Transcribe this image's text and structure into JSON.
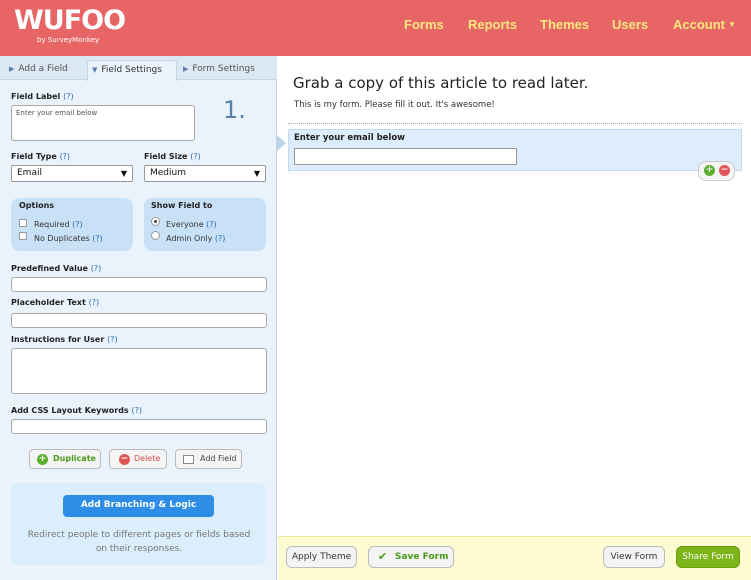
{
  "header": {
    "logo": "WUFOO",
    "logo_sub": "by SurveyMonkey",
    "nav": {
      "forms": "Forms",
      "reports": "Reports",
      "themes": "Themes",
      "users": "Users",
      "account": "Account"
    },
    "colors": {
      "background": "#e86565",
      "nav_text": "#f9e87f"
    }
  },
  "sidebar": {
    "tabs": {
      "add_field": "Add a Field",
      "field_settings": "Field Settings",
      "form_settings": "Form Settings"
    },
    "active_tab": "Field Settings",
    "field_number": "1.",
    "field_label": {
      "label": "Field Label",
      "help": "(?)",
      "value": "Enter your email below"
    },
    "field_type": {
      "label": "Field Type",
      "help": "(?)",
      "value": "Email"
    },
    "field_size": {
      "label": "Field Size",
      "help": "(?)",
      "value": "Medium"
    },
    "options": {
      "title": "Options",
      "required": {
        "label": "Required",
        "help": "(?)",
        "checked": false
      },
      "no_duplicates": {
        "label": "No Duplicates",
        "help": "(?)",
        "checked": false
      }
    },
    "show_field_to": {
      "title": "Show Field to",
      "everyone": {
        "label": "Everyone",
        "help": "(?)",
        "selected": true
      },
      "admin_only": {
        "label": "Admin Only",
        "help": "(?)",
        "selected": false
      }
    },
    "predefined_value": {
      "label": "Predefined Value",
      "help": "(?)",
      "value": ""
    },
    "placeholder_text": {
      "label": "Placeholder Text",
      "help": "(?)",
      "value": ""
    },
    "instructions": {
      "label": "Instructions for User",
      "help": "(?)",
      "value": ""
    },
    "css_keywords": {
      "label": "Add CSS Layout Keywords",
      "help": "(?)",
      "value": ""
    },
    "buttons": {
      "duplicate": "Duplicate",
      "delete": "Delete",
      "add_field": "Add Field"
    },
    "logic": {
      "button": "Add Branching & Logic",
      "text": "Redirect people to different pages or fields based on their responses."
    }
  },
  "main": {
    "form_title": "Grab a copy of this article to read later.",
    "form_description": "This is my form. Please fill it out. It's awesome!",
    "field_label": "Enter your email below"
  },
  "footer": {
    "apply_theme": "Apply Theme",
    "save_form": "Save Form",
    "view_form": "View Form",
    "share_form": "Share Form",
    "colors": {
      "share": "#7cb518",
      "save_text": "#4a9a1a"
    }
  }
}
